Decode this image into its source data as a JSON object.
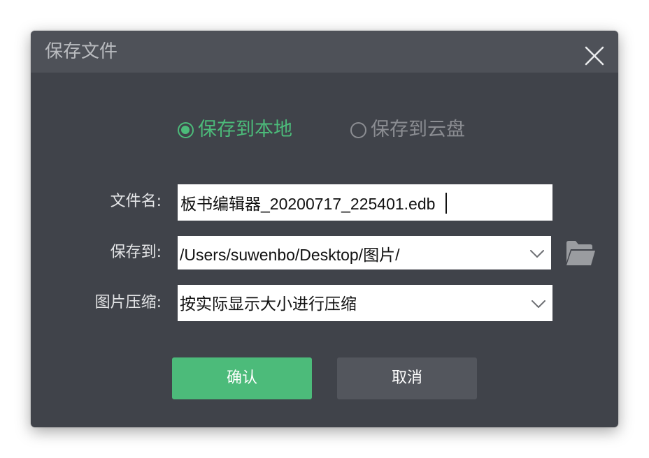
{
  "dialog": {
    "title": "保存文件",
    "close_icon": "close-icon"
  },
  "save_target": {
    "local_label": "保存到本地",
    "cloud_label": "保存到云盘",
    "selected": "local"
  },
  "fields": {
    "filename_label": "文件名:",
    "filename_value": "板书编辑器_20200717_225401.edb",
    "path_label": "保存到:",
    "path_value": "/Users/suwenbo/Desktop/图片/",
    "compress_label": "图片压缩:",
    "compress_value": "按实际显示大小进行压缩"
  },
  "icons": {
    "dropdown": "chevron-down-icon",
    "browse": "folder-open-icon"
  },
  "buttons": {
    "confirm_label": "确认",
    "cancel_label": "取消"
  },
  "colors": {
    "accent": "#4cbb7a",
    "dialog_bg": "#40434a",
    "titlebar_bg": "#4e5158",
    "cancel_bg": "#53565d"
  }
}
